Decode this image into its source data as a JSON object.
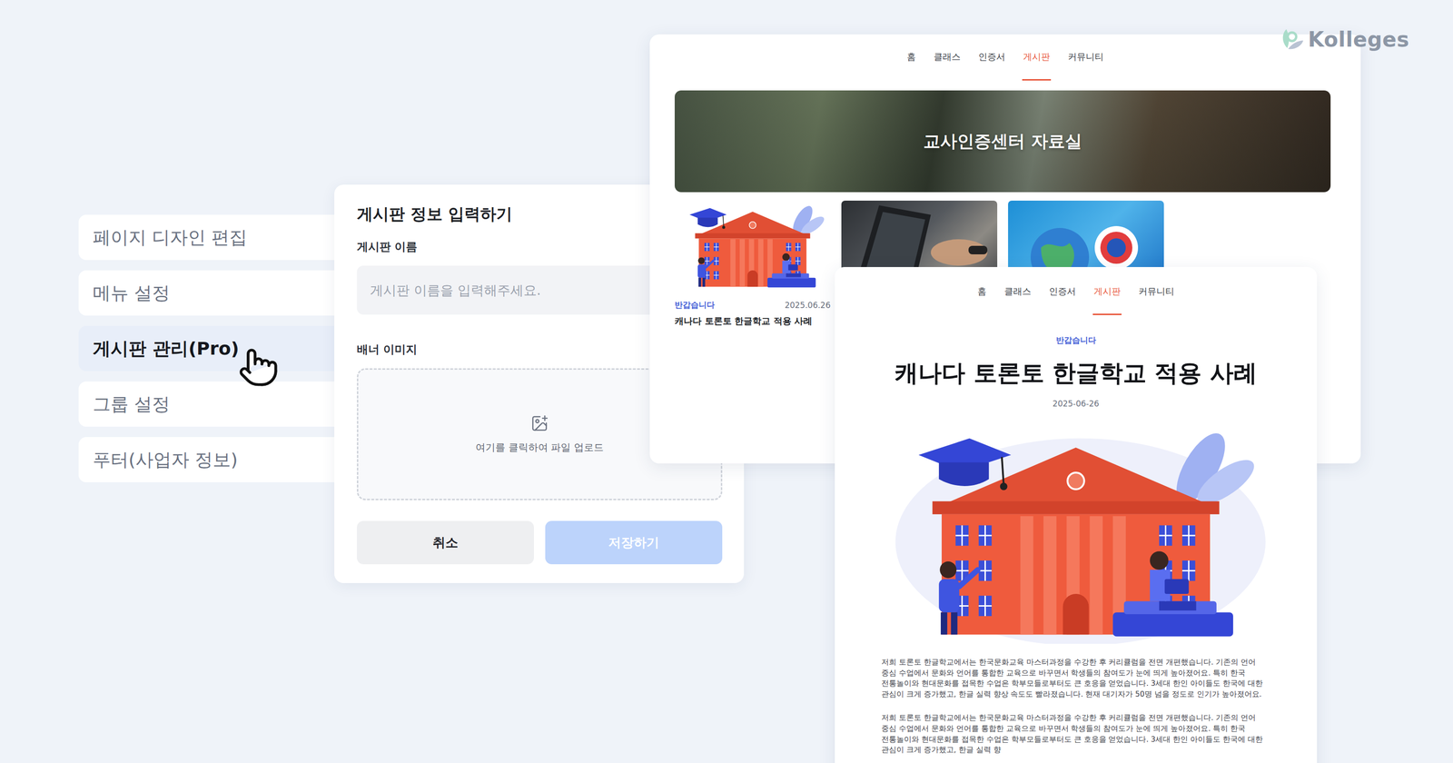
{
  "logo": {
    "text": "Kolleges"
  },
  "sidebar": {
    "items": [
      {
        "label": "페이지 디자인 편집",
        "selected": false
      },
      {
        "label": "메뉴 설정",
        "selected": false
      },
      {
        "label": "게시판 관리(Pro)",
        "selected": true
      },
      {
        "label": "그룹 설정",
        "selected": false
      },
      {
        "label": "푸터(사업자 정보)",
        "selected": false
      }
    ]
  },
  "form": {
    "title": "게시판 정보 입력하기",
    "name_label": "게시판 이름",
    "name_placeholder": "게시판 이름을 입력해주세요.",
    "banner_label": "배너 이미지",
    "upload_text": "여기를 클릭하여 파일 업로드",
    "buttons": [
      {
        "label": "취소",
        "kind": "secondary",
        "disabled": false
      },
      {
        "label": "저장하기",
        "kind": "primary",
        "disabled": true
      }
    ]
  },
  "board_page": {
    "nav": [
      {
        "label": "홈",
        "selected": false
      },
      {
        "label": "클래스",
        "selected": false
      },
      {
        "label": "인증서",
        "selected": false
      },
      {
        "label": "게시판",
        "selected": true
      },
      {
        "label": "커뮤니티",
        "selected": false
      }
    ],
    "banner_title": "교사인증센터 자료실",
    "posts": [
      {
        "kind": "illustration",
        "tag": "반갑습니다",
        "date": "2025.06.26",
        "title": "캐나다 토론토 한글학교 적용 사례"
      },
      {
        "kind": "photo"
      },
      {
        "kind": "badge"
      }
    ]
  },
  "post_page": {
    "nav": [
      {
        "label": "홈",
        "selected": false
      },
      {
        "label": "클래스",
        "selected": false
      },
      {
        "label": "인증서",
        "selected": false
      },
      {
        "label": "게시판",
        "selected": true
      },
      {
        "label": "커뮤니티",
        "selected": false
      }
    ],
    "tag": "반갑습니다",
    "title": "캐나다 토론토 한글학교 적용 사례",
    "date": "2025-06-26",
    "paragraphs": [
      "저희 토론토 한글학교에서는 한국문화교육 마스터과정을 수강한 후 커리큘럼을 전면 개편했습니다. 기존의 언어 중심 수업에서 문화와 언어를 통합한 교육으로 바꾸면서 학생들의 참여도가 눈에 띄게 높아졌어요. 특히 한국 전통놀이와 현대문화를 접목한 수업은 학부모들로부터도 큰 호응을 얻었습니다. 3세대 한인 아이들도 한국에 대한 관심이 크게 증가했고, 한글 실력 향상 속도도 빨라졌습니다. 현재 대기자가 50명 넘을 정도로 인기가 높아졌어요.",
      "저희 토론토 한글학교에서는 한국문화교육 마스터과정을 수강한 후 커리큘럼을 전면 개편했습니다. 기존의 언어 중심 수업에서 문화와 언어를 통합한 교육으로 바꾸면서 학생들의 참여도가 눈에 띄게 높아졌어요. 특히 한국 전통놀이와 현대문화를 접목한 수업은 학부모들로부터도 큰 호응을 얻었습니다. 3세대 한인 아이들도 한국에 대한 관심이 크게 증가했고, 한글 실력 향"
    ]
  }
}
